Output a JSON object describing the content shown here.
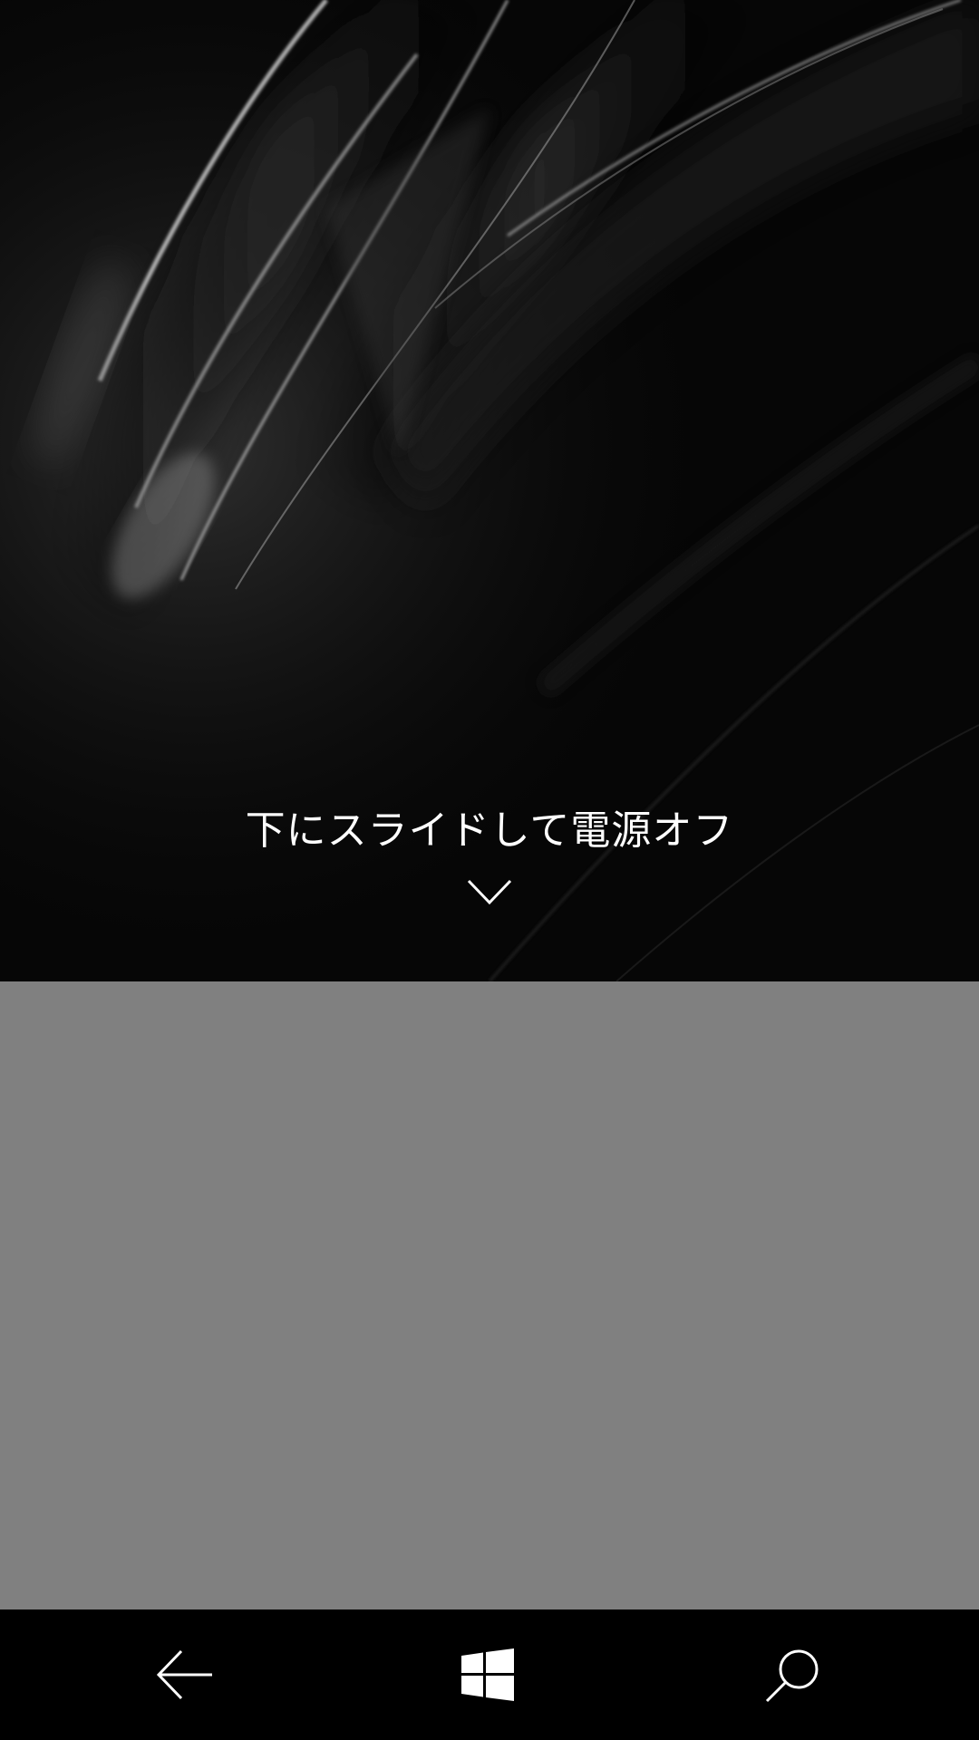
{
  "slide_panel": {
    "instruction": "下にスライドして電源オフ",
    "chevron_icon": "chevron-down-icon"
  },
  "gray_area": {
    "color": "#808080"
  },
  "nav_bar": {
    "back_icon": "back-arrow-icon",
    "home_icon": "windows-logo-icon",
    "search_icon": "search-icon",
    "icon_color": "#ffffff"
  }
}
